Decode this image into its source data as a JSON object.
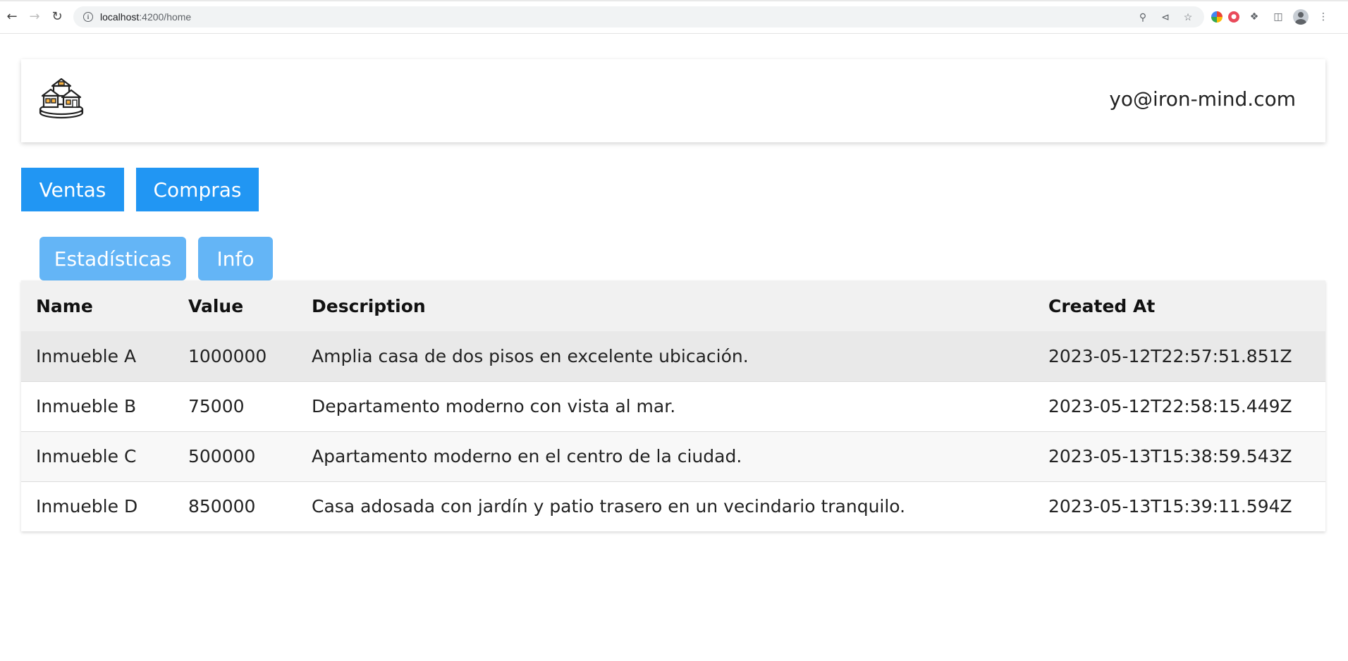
{
  "browser": {
    "url_host": "localhost",
    "url_path": ":4200/home"
  },
  "header": {
    "logo_icon": "house-coins-icon",
    "user_email": "yo@iron-mind.com"
  },
  "actions": {
    "ventas_label": "Ventas",
    "compras_label": "Compras"
  },
  "tabs": {
    "estadisticas_label": "Estadísticas",
    "info_label": "Info"
  },
  "colors": {
    "primary": "#2196f3",
    "tab": "#64b5f6"
  },
  "table": {
    "columns": [
      "Name",
      "Value",
      "Description",
      "Created At"
    ],
    "rows": [
      {
        "name": "Inmueble A",
        "value": "1000000",
        "description": "Amplia casa de dos pisos en excelente ubicación.",
        "created_at": "2023-05-12T22:57:51.851Z"
      },
      {
        "name": "Inmueble B",
        "value": "75000",
        "description": "Departamento moderno con vista al mar.",
        "created_at": "2023-05-12T22:58:15.449Z"
      },
      {
        "name": "Inmueble C",
        "value": "500000",
        "description": "Apartamento moderno en el centro de la ciudad.",
        "created_at": "2023-05-13T15:38:59.543Z"
      },
      {
        "name": "Inmueble D",
        "value": "850000",
        "description": "Casa adosada con jardín y patio trasero en un vecindario tranquilo.",
        "created_at": "2023-05-13T15:39:11.594Z"
      }
    ]
  }
}
